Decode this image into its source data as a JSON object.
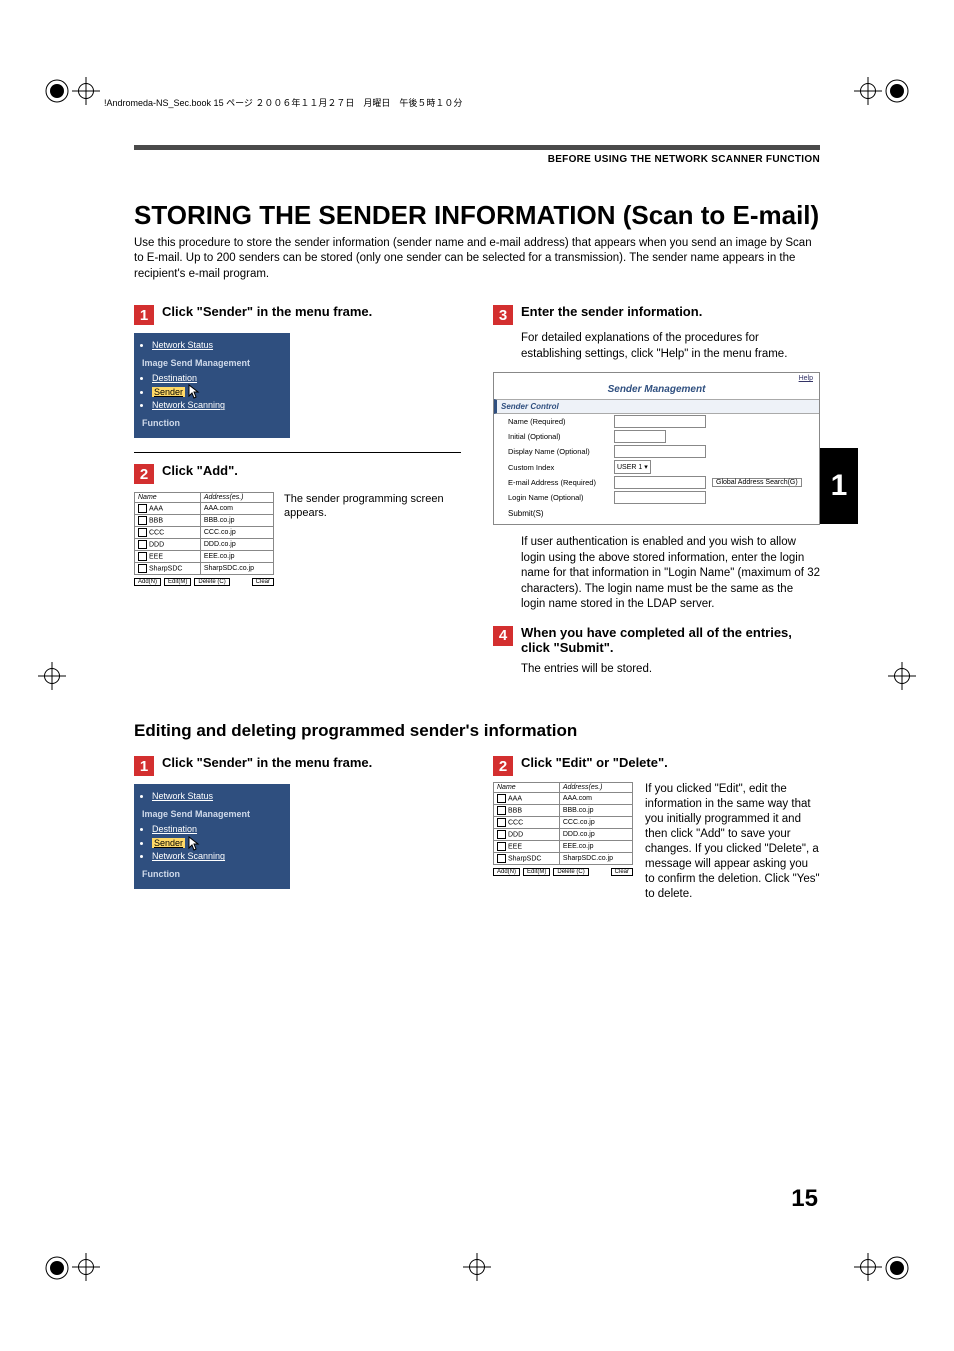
{
  "header_line": "!Andromeda-NS_Sec.book  15 ページ  ２００６年１１月２７日　月曜日　午後５時１０分",
  "section_header": "BEFORE USING THE NETWORK SCANNER FUNCTION",
  "title": "STORING THE SENDER INFORMATION (Scan to E-mail)",
  "intro": "Use this procedure to store the sender information (sender name and e-mail address) that appears when you send an image by Scan to E-mail. Up to 200 senders can be stored (only one sender can be selected for a transmission). The sender name appears in the recipient's e-mail program.",
  "chapter_tab": "1",
  "page_number": "15",
  "stepsA": {
    "s1": {
      "num": "1",
      "title": "Click \"Sender\" in the menu frame."
    },
    "s2": {
      "num": "2",
      "title": "Click \"Add\".",
      "caption": "The sender programming screen appears."
    },
    "s3": {
      "num": "3",
      "title": "Enter the sender information.",
      "desc": "For detailed explanations of the procedures for establishing settings, click \"Help\" in the menu frame.",
      "desc2": "If user authentication is enabled and you wish to allow login using the above stored information, enter the login name for that information in \"Login Name\" (maximum of 32 characters). The login name must be the same as the login name stored in the LDAP server."
    },
    "s4": {
      "num": "4",
      "title": "When you have completed all of the entries, click \"Submit\".",
      "desc": "The entries will be stored."
    }
  },
  "menu": {
    "network_status": "Network Status",
    "group": "Image Send Management",
    "destination": "Destination",
    "sender": "Sender",
    "network_scanning": "Network Scanning",
    "function": "Function"
  },
  "addr": {
    "hdr_name": "Name",
    "hdr_addr": "Address(es.)",
    "rows": [
      {
        "n": "AAA",
        "a": "AAA.com"
      },
      {
        "n": "BBB",
        "a": "BBB.co.jp"
      },
      {
        "n": "CCC",
        "a": "CCC.co.jp"
      },
      {
        "n": "DDD",
        "a": "DDD.co.jp"
      },
      {
        "n": "EEE",
        "a": "EEE.co.jp"
      },
      {
        "n": "SharpSDC",
        "a": "SharpSDC.co.jp"
      }
    ],
    "btn_add": "Add(N)",
    "btn_edit": "Edit(M)",
    "btn_delete": "Delete (C)",
    "btn_clear": "Clear"
  },
  "sm": {
    "help": "Help",
    "title": "Sender Management",
    "section": "Sender Control",
    "name": "Name (Required)",
    "initial": "Initial (Optional)",
    "display": "Display Name (Optional)",
    "custom_index": "Custom Index",
    "custom_index_val": "USER 1 ▾",
    "email": "E-mail Address (Required)",
    "global_btn": "Global Address Search(G)",
    "login": "Login Name (Optional)",
    "submit": "Submit(S)"
  },
  "subheading": "Editing and deleting programmed sender's information",
  "stepsB": {
    "s1": {
      "num": "1",
      "title": "Click \"Sender\" in the menu frame."
    },
    "s2": {
      "num": "2",
      "title": "Click \"Edit\" or \"Delete\".",
      "desc": "If you clicked \"Edit\", edit the information in the same way that you initially programmed it and then click \"Add\" to save your changes. If you clicked \"Delete\", a message will appear asking you to confirm the deletion. Click \"Yes\" to delete."
    }
  }
}
